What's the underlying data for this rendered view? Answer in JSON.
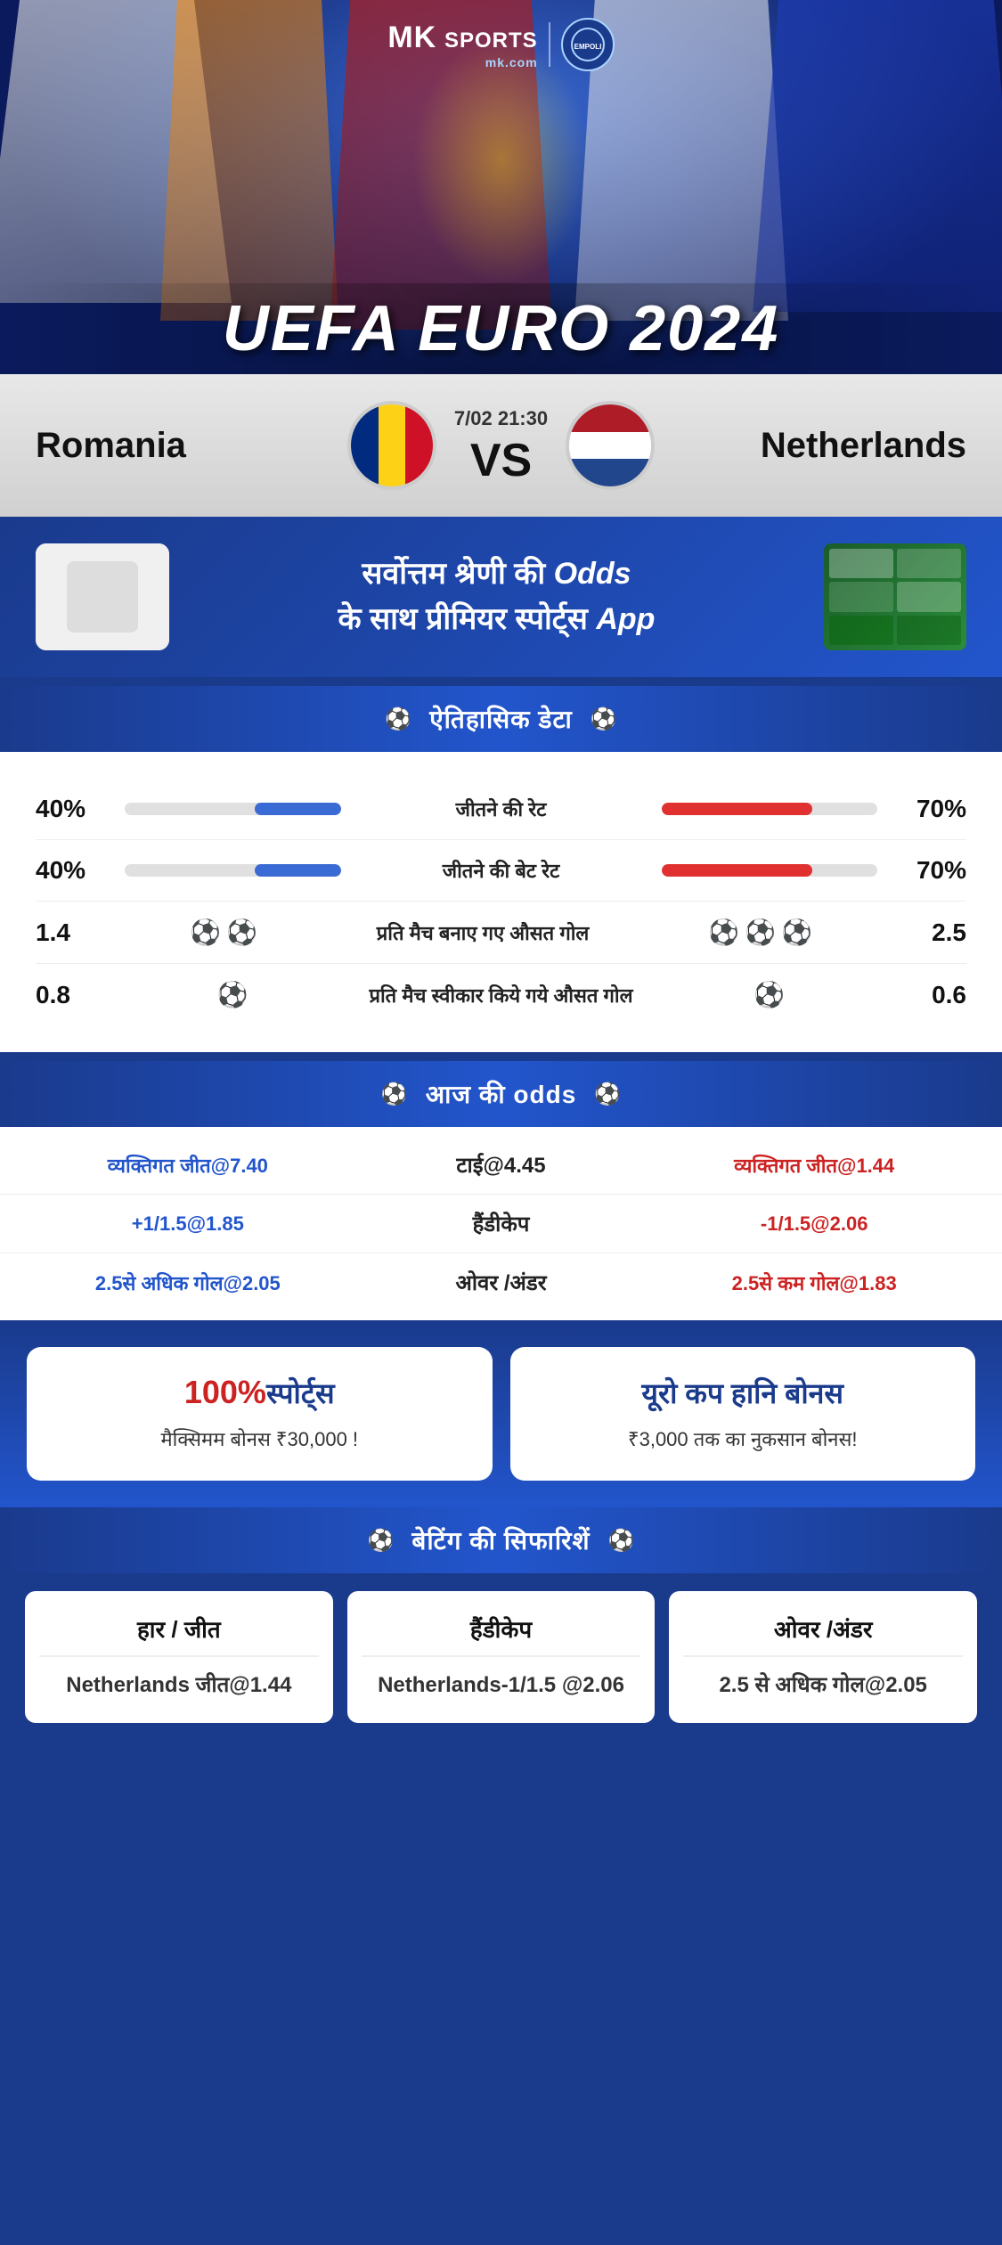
{
  "brand": {
    "mk_text": "MK SPORTS",
    "mk_sub": "mk.com",
    "divider": "|"
  },
  "event": {
    "title": "UEFA EURO 2024",
    "team_left": "Romania",
    "team_right": "Netherlands",
    "date": "7/02 21:30",
    "vs": "VS"
  },
  "app_promo": {
    "line1": "सर्वोत्तम श्रेणी की",
    "bold": "Odds",
    "line2": "के साथ प्रीमियर स्पोर्ट्स",
    "bold2": "App"
  },
  "historical": {
    "header": "ऐतिहासिक डेटा",
    "rows": [
      {
        "label": "जीतने की रेट",
        "left_val": "40%",
        "right_val": "70%",
        "left_pct": 40,
        "right_pct": 70
      },
      {
        "label": "जीतने की बेट रेट",
        "left_val": "40%",
        "right_val": "70%",
        "left_pct": 40,
        "right_pct": 70
      },
      {
        "label": "प्रति मैच बनाए गए औसत गोल",
        "left_val": "1.4",
        "right_val": "2.5",
        "left_icons": "⚽",
        "right_icons": "⚽⚽"
      },
      {
        "label": "प्रति मैच स्वीकार किये गये औसत गोल",
        "left_val": "0.8",
        "right_val": "0.6",
        "left_icons": "⚽",
        "right_icons": "⚽"
      }
    ]
  },
  "odds": {
    "header": "आज की odds",
    "rows": [
      {
        "left": "व्यक्तिगत जीत@7.40",
        "center": "टाई@4.45",
        "right": "व्यक्तिगत जीत@1.44",
        "left_color": "blue",
        "right_color": "red"
      },
      {
        "left": "+1/1.5@1.85",
        "center": "हैंडीकेप",
        "right": "-1/1.5@2.06",
        "left_color": "blue",
        "right_color": "red"
      },
      {
        "left": "2.5से अधिक गोल@2.05",
        "center": "ओवर /अंडर",
        "right": "2.5से कम गोल@1.83",
        "left_color": "blue",
        "right_color": "red"
      }
    ]
  },
  "bonus": {
    "card1": {
      "title_red": "100%",
      "title_blue": "स्पोर्ट्स",
      "desc": "मैक्सिमम बोनस  ₹30,000 !"
    },
    "card2": {
      "title": "यूरो कप हानि बोनस",
      "desc": "₹3,000 तक का नुकसान बोनस!"
    }
  },
  "recommendations": {
    "header": "बेटिंग की सिफारिशें",
    "cards": [
      {
        "title": "हार / जीत",
        "value": "Netherlands जीत@1.44"
      },
      {
        "title": "हैंडीकेप",
        "value": "Netherlands-1/1.5 @2.06"
      },
      {
        "title": "ओवर /अंडर",
        "value": "2.5 से अधिक गोल@2.05"
      }
    ]
  }
}
